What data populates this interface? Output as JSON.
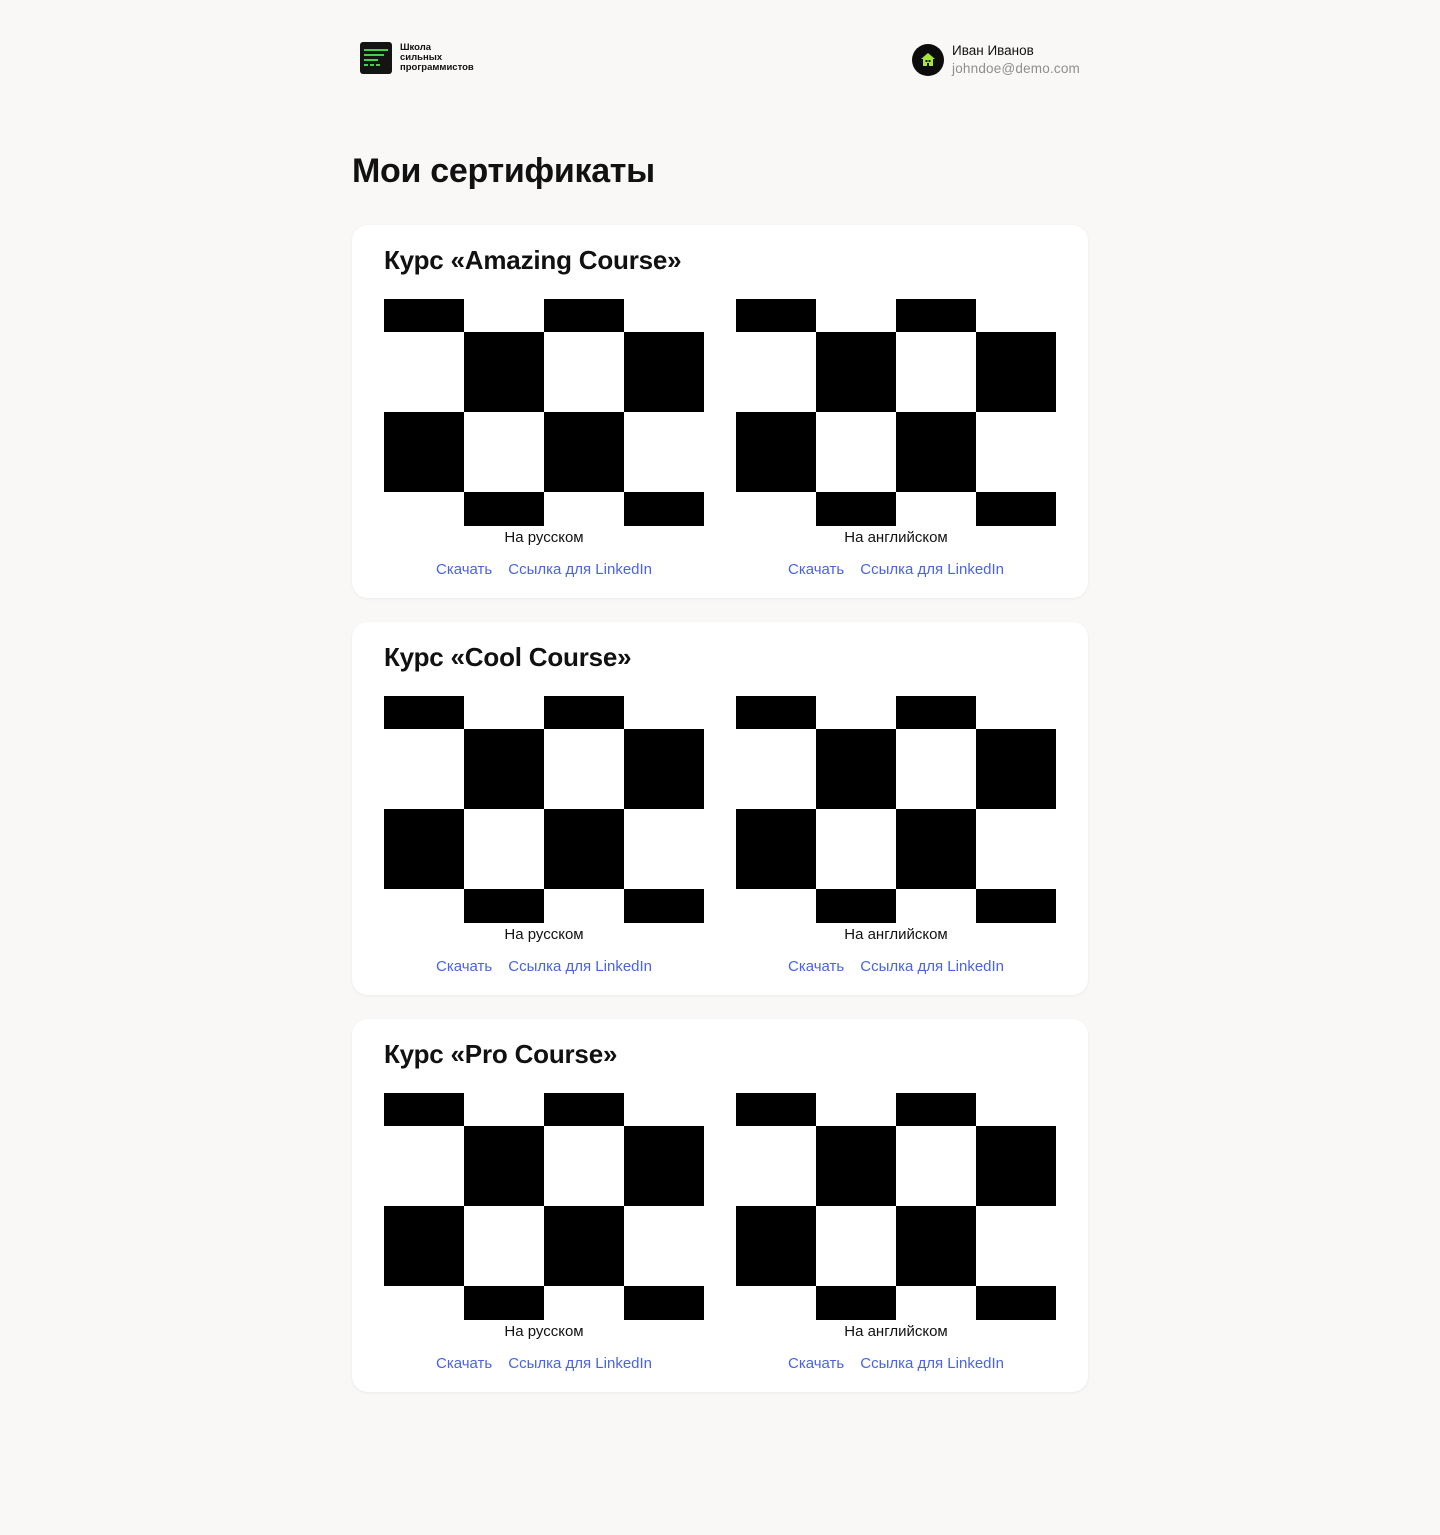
{
  "header": {
    "logo_lines": [
      "Школа",
      "сильных",
      "программистов"
    ],
    "user": {
      "name": "Иван Иванов",
      "email": "johndoe@demo.com"
    }
  },
  "page_title": "Мои сертификаты",
  "courses": [
    {
      "title": "Курс «Amazing Course»",
      "certificates": [
        {
          "label": "На русском",
          "download": "Скачать",
          "linkedin": "Ссылка для LinkedIn"
        },
        {
          "label": "На английском",
          "download": "Скачать",
          "linkedin": "Ссылка для LinkedIn"
        }
      ]
    },
    {
      "title": "Курс «Cool Course»",
      "certificates": [
        {
          "label": "На русском",
          "download": "Скачать",
          "linkedin": "Ссылка для LinkedIn"
        },
        {
          "label": "На английском",
          "download": "Скачать",
          "linkedin": "Ссылка для LinkedIn"
        }
      ]
    },
    {
      "title": "Курс «Pro Course»",
      "certificates": [
        {
          "label": "На русском",
          "download": "Скачать",
          "linkedin": "Ссылка для LinkedIn"
        },
        {
          "label": "На английском",
          "download": "Скачать",
          "linkedin": "Ссылка для LinkedIn"
        }
      ]
    }
  ],
  "colors": {
    "accent_link": "#4a64e0",
    "logo_green": "#3fd14a",
    "background": "#f9f8f6"
  },
  "icons": {
    "logo": "school-logo-icon",
    "avatar": "avatar-house-icon",
    "certificate": "certificate-placeholder-checker"
  }
}
